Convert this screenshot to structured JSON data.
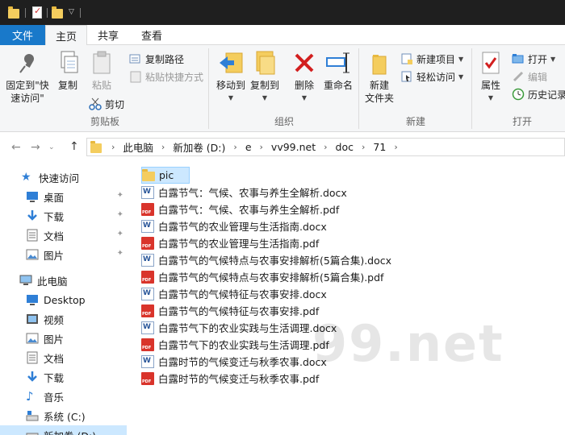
{
  "ribbon_tabs": {
    "file": "文件",
    "home": "主页",
    "share": "共享",
    "view": "查看"
  },
  "ribbon": {
    "clipboard": {
      "label": "剪贴板",
      "pin_quick_access": "固定到\"快速访问\"",
      "copy": "复制",
      "paste": "粘贴",
      "copy_path": "复制路径",
      "paste_shortcut": "粘贴快捷方式",
      "cut": "剪切"
    },
    "organize": {
      "label": "组织",
      "move_to": "移动到",
      "copy_to": "复制到",
      "delete": "删除",
      "rename": "重命名"
    },
    "new": {
      "label": "新建",
      "new_folder": "新建\n文件夹",
      "new_item": "新建项目",
      "easy_access": "轻松访问"
    },
    "open": {
      "label": "打开",
      "properties": "属性",
      "open": "打开",
      "edit": "编辑",
      "history": "历史记录"
    }
  },
  "breadcrumb": [
    "此电脑",
    "新加卷 (D:)",
    "e",
    "vv99.net",
    "doc",
    "71"
  ],
  "nav": {
    "quick_access": "快速访问",
    "desktop": "桌面",
    "downloads": "下载",
    "documents": "文档",
    "pictures": "图片",
    "this_pc": "此电脑",
    "pc_desktop": "Desktop",
    "videos": "视频",
    "pc_pictures": "图片",
    "pc_documents": "文档",
    "pc_downloads": "下载",
    "music": "音乐",
    "system_c": "系统 (C:)",
    "new_volume_d": "新加卷 (D:)"
  },
  "files": [
    {
      "name": "pic",
      "type": "folder"
    },
    {
      "name": "白露节气：气候、农事与养生全解析.docx",
      "type": "docx"
    },
    {
      "name": "白露节气：气候、农事与养生全解析.pdf",
      "type": "pdf"
    },
    {
      "name": "白露节气的农业管理与生活指南.docx",
      "type": "docx"
    },
    {
      "name": "白露节气的农业管理与生活指南.pdf",
      "type": "pdf"
    },
    {
      "name": "白露节气的气候特点与农事安排解析(5篇合集).docx",
      "type": "docx"
    },
    {
      "name": "白露节气的气候特点与农事安排解析(5篇合集).pdf",
      "type": "pdf"
    },
    {
      "name": "白露节气的气候特征与农事安排.docx",
      "type": "docx"
    },
    {
      "name": "白露节气的气候特征与农事安排.pdf",
      "type": "pdf"
    },
    {
      "name": "白露节气下的农业实践与生活调理.docx",
      "type": "docx"
    },
    {
      "name": "白露节气下的农业实践与生活调理.pdf",
      "type": "pdf"
    },
    {
      "name": "白露时节的气候变迁与秋季农事.docx",
      "type": "docx"
    },
    {
      "name": "白露时节的气候变迁与秋季农事.pdf",
      "type": "pdf"
    }
  ],
  "watermark": "99.net",
  "colors": {
    "file_tab": "#1979ca",
    "selection": "#cce8ff",
    "folder": "#f4cd5e",
    "pdf": "#d9342b",
    "word": "#2b579a"
  }
}
